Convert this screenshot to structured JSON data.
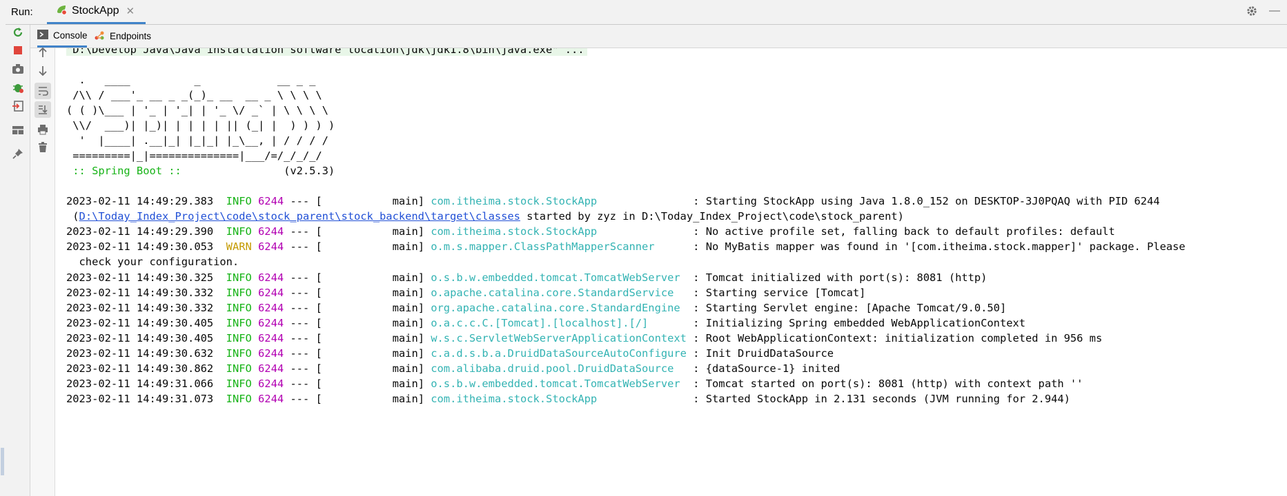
{
  "runbar": {
    "label": "Run:",
    "tab_label": "StockApp",
    "close_glyph": "✕",
    "minimize_glyph": "—"
  },
  "subtabs": [
    {
      "label": "Console"
    },
    {
      "label": "Endpoints"
    }
  ],
  "left_toolbar": [
    "rerun-icon",
    "stop-icon",
    "camera-icon",
    "debug-icon",
    "exit-icon",
    "layout-icon",
    "pin-icon"
  ],
  "side_toolbar": [
    "up-arrow-icon",
    "down-arrow-icon",
    "soft-wrap-icon",
    "scroll-to-end-icon",
    "print-icon",
    "trash-icon"
  ],
  "colors": {
    "info": "#17b317",
    "warn": "#c49a00",
    "pid": "#b200b2",
    "logger": "#33b3b3",
    "link": "#2150d6",
    "accent": "#4083c9"
  },
  "console": {
    "command": "\"D:\\Develop Java\\Java installation software location\\jdk\\jdk1.8\\bin\\java.exe\" ...",
    "banner": [
      "  .   ____          _            __ _ _",
      " /\\\\ / ___'_ __ _ _(_)_ __  __ _ \\ \\ \\ \\",
      "( ( )\\___ | '_ | '_| | '_ \\/ _` | \\ \\ \\ \\",
      " \\\\/  ___)| |_)| | | | | || (_| |  ) ) ) )",
      "  '  |____| .__|_| |_|_| |_\\__, | / / / /",
      " =========|_|==============|___/=/_/_/_/"
    ],
    "spring_label": " :: Spring Boot :: ",
    "spring_version": "(v2.5.3)",
    "logs": [
      {
        "ts": "2023-02-11 14:49:29.383",
        "level": "INFO",
        "pid": "6244",
        "thread": "main",
        "logger": "com.itheima.stock.StockApp",
        "msg": "Starting StockApp using Java 1.8.0_152 on DESKTOP-3J0PQAQ with PID 6244"
      },
      {
        "ts": "2023-02-11 14:49:29.390",
        "level": "INFO",
        "pid": "6244",
        "thread": "main",
        "logger": "com.itheima.stock.StockApp",
        "msg": "No active profile set, falling back to default profiles: default"
      },
      {
        "ts": "2023-02-11 14:49:30.053",
        "level": "WARN",
        "pid": "6244",
        "thread": "main",
        "logger": "o.m.s.mapper.ClassPathMapperScanner",
        "msg": "No MyBatis mapper was found in '[com.itheima.stock.mapper]' package. Please"
      },
      {
        "ts": "2023-02-11 14:49:30.325",
        "level": "INFO",
        "pid": "6244",
        "thread": "main",
        "logger": "o.s.b.w.embedded.tomcat.TomcatWebServer",
        "msg": "Tomcat initialized with port(s): 8081 (http)"
      },
      {
        "ts": "2023-02-11 14:49:30.332",
        "level": "INFO",
        "pid": "6244",
        "thread": "main",
        "logger": "o.apache.catalina.core.StandardService",
        "msg": "Starting service [Tomcat]"
      },
      {
        "ts": "2023-02-11 14:49:30.332",
        "level": "INFO",
        "pid": "6244",
        "thread": "main",
        "logger": "org.apache.catalina.core.StandardEngine",
        "msg": "Starting Servlet engine: [Apache Tomcat/9.0.50]"
      },
      {
        "ts": "2023-02-11 14:49:30.405",
        "level": "INFO",
        "pid": "6244",
        "thread": "main",
        "logger": "o.a.c.c.C.[Tomcat].[localhost].[/]",
        "msg": "Initializing Spring embedded WebApplicationContext"
      },
      {
        "ts": "2023-02-11 14:49:30.405",
        "level": "INFO",
        "pid": "6244",
        "thread": "main",
        "logger": "w.s.c.ServletWebServerApplicationContext",
        "msg": "Root WebApplicationContext: initialization completed in 956 ms"
      },
      {
        "ts": "2023-02-11 14:49:30.632",
        "level": "INFO",
        "pid": "6244",
        "thread": "main",
        "logger": "c.a.d.s.b.a.DruidDataSourceAutoConfigure",
        "msg": "Init DruidDataSource"
      },
      {
        "ts": "2023-02-11 14:49:30.862",
        "level": "INFO",
        "pid": "6244",
        "thread": "main",
        "logger": "com.alibaba.druid.pool.DruidDataSource",
        "msg": "{dataSource-1} inited"
      },
      {
        "ts": "2023-02-11 14:49:31.066",
        "level": "INFO",
        "pid": "6244",
        "thread": "main",
        "logger": "o.s.b.w.embedded.tomcat.TomcatWebServer",
        "msg": "Tomcat started on port(s): 8081 (http) with context path ''"
      },
      {
        "ts": "2023-02-11 14:49:31.073",
        "level": "INFO",
        "pid": "6244",
        "thread": "main",
        "logger": "com.itheima.stock.StockApp",
        "msg": "Started StockApp in 2.131 seconds (JVM running for 2.944)"
      }
    ],
    "continuations": {
      "0": {
        "prefix": " (",
        "link": "D:\\Today_Index_Project\\code\\stock_parent\\stock_backend\\target\\classes",
        "suffix": " started by zyz in D:\\Today_Index_Project\\code\\stock_parent)"
      },
      "2": {
        "text": "  check your configuration."
      }
    }
  }
}
